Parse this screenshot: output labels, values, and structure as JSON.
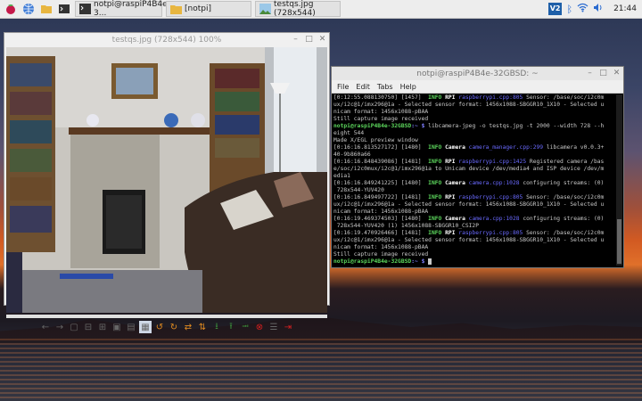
{
  "taskbar": {
    "tasks": [
      {
        "label": "notpi@raspiP4B4e-3..."
      },
      {
        "label": "[notpi]"
      },
      {
        "label": "testqs.jpg (728x544)"
      }
    ],
    "clock": "21:44",
    "vnc_label": "V2"
  },
  "viewer": {
    "title": "testqs.jpg (728x544) 100%"
  },
  "terminal": {
    "title": "notpi@raspiP4B4e-32GBSD: ~",
    "menu": [
      "File",
      "Edit",
      "Tabs",
      "Help"
    ],
    "lines": [
      [
        {
          "t": "[0:12:55.088130750] [1457]  "
        },
        {
          "t": "INFO",
          "c": "info"
        },
        {
          "t": " "
        },
        {
          "t": "RPI",
          "c": "mod"
        },
        {
          "t": " "
        },
        {
          "t": "raspberrypi.cpp:805",
          "c": "src"
        },
        {
          "t": " Sensor: /base/soc/i2c0m"
        }
      ],
      [
        {
          "t": "ux/i2c@1/imx296@1a - Selected sensor format: 1456x1088-SBGGR10_1X10 - Selected u"
        }
      ],
      [
        {
          "t": "nicam format: 1456x1088-pBAA"
        }
      ],
      [
        {
          "t": "Still capture image received"
        }
      ],
      [
        {
          "t": "notpi@raspiP4B4e-32GBSD",
          "c": "p"
        },
        {
          "t": ":~ $ ",
          "c": "pu"
        },
        {
          "t": "libcamera-jpeg -o testqs.jpg -t 2000 --width 728 --h"
        }
      ],
      [
        {
          "t": "eight 544"
        }
      ],
      [
        {
          "t": "Made X/EGL preview window"
        }
      ],
      [
        {
          "t": "[0:16:16.813527172] [1480]  "
        },
        {
          "t": "INFO",
          "c": "info"
        },
        {
          "t": " "
        },
        {
          "t": "Camera",
          "c": "mod"
        },
        {
          "t": " "
        },
        {
          "t": "camera_manager.cpp:299",
          "c": "src"
        },
        {
          "t": " libcamera v0.0.3+"
        }
      ],
      [
        {
          "t": "40-9b860a66"
        }
      ],
      [
        {
          "t": "[0:16:16.848439086] [1481]  "
        },
        {
          "t": "INFO",
          "c": "info"
        },
        {
          "t": " "
        },
        {
          "t": "RPI",
          "c": "mod"
        },
        {
          "t": " "
        },
        {
          "t": "raspberrypi.cpp:1425",
          "c": "src"
        },
        {
          "t": " Registered camera /bas"
        }
      ],
      [
        {
          "t": "e/soc/i2c0mux/i2c@1/imx296@1a to Unicam device /dev/media4 and ISP device /dev/m"
        }
      ],
      [
        {
          "t": "edia1"
        }
      ],
      [
        {
          "t": "[0:16:16.849241225] [1480]  "
        },
        {
          "t": "INFO",
          "c": "info"
        },
        {
          "t": " "
        },
        {
          "t": "Camera",
          "c": "mod"
        },
        {
          "t": " "
        },
        {
          "t": "camera.cpp:1028",
          "c": "src"
        },
        {
          "t": " configuring streams: (0)"
        }
      ],
      [
        {
          "t": " 728x544-YUV420"
        }
      ],
      [
        {
          "t": "[0:16:16.849497722] [1481]  "
        },
        {
          "t": "INFO",
          "c": "info"
        },
        {
          "t": " "
        },
        {
          "t": "RPI",
          "c": "mod"
        },
        {
          "t": " "
        },
        {
          "t": "raspberrypi.cpp:805",
          "c": "src"
        },
        {
          "t": " Sensor: /base/soc/i2c0m"
        }
      ],
      [
        {
          "t": "ux/i2c@1/imx296@1a - Selected sensor format: 1456x1088-SBGGR10_1X10 - Selected u"
        }
      ],
      [
        {
          "t": "nicam format: 1456x1088-pBAA"
        }
      ],
      [
        {
          "t": "[0:16:19.469374503] [1480]  "
        },
        {
          "t": "INFO",
          "c": "info"
        },
        {
          "t": " "
        },
        {
          "t": "Camera",
          "c": "mod"
        },
        {
          "t": " "
        },
        {
          "t": "camera.cpp:1028",
          "c": "src"
        },
        {
          "t": " configuring streams: (0)"
        }
      ],
      [
        {
          "t": " 728x544-YUV420 (1) 1456x1088-SBGGR10_CSI2P"
        }
      ],
      [
        {
          "t": "[0:16:19.470926466] [1481]  "
        },
        {
          "t": "INFO",
          "c": "info"
        },
        {
          "t": " "
        },
        {
          "t": "RPI",
          "c": "mod"
        },
        {
          "t": " "
        },
        {
          "t": "raspberrypi.cpp:805",
          "c": "src"
        },
        {
          "t": " Sensor: /base/soc/i2c0m"
        }
      ],
      [
        {
          "t": "ux/i2c@1/imx296@1a - Selected sensor format: 1456x1088-SBGGR10_1X10 - Selected u"
        }
      ],
      [
        {
          "t": "nicam format: 1456x1088-pBAA"
        }
      ],
      [
        {
          "t": "Still capture image received"
        }
      ],
      [
        {
          "t": "notpi@raspiP4B4e-32GBSD",
          "c": "p"
        },
        {
          "t": ":~ $ ",
          "c": "pu"
        },
        {
          "t": " ",
          "c": "curs"
        }
      ]
    ]
  }
}
